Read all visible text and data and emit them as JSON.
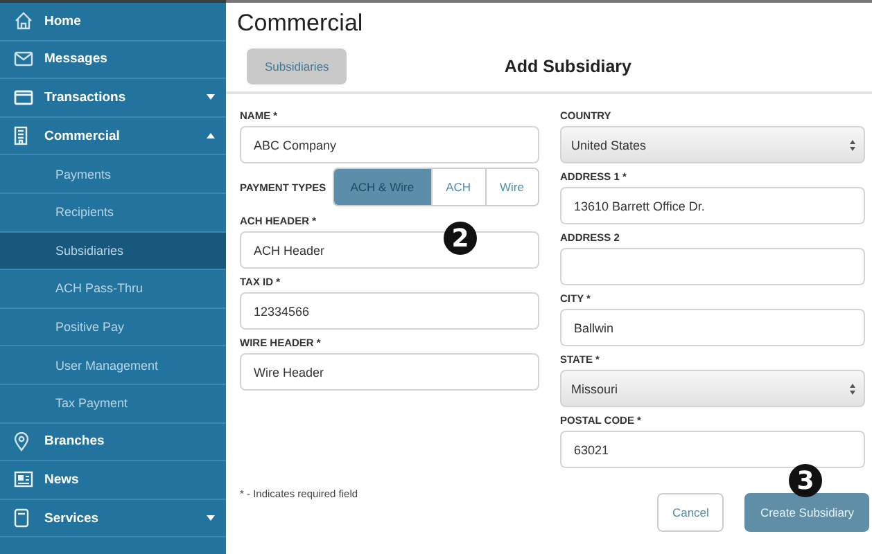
{
  "nav": {
    "items": [
      {
        "label": "Home",
        "selected": false
      },
      {
        "label": "Messages",
        "selected": false
      },
      {
        "label": "Transactions",
        "selected": false,
        "expanded": false
      },
      {
        "label": "Commercial",
        "selected": false,
        "expanded": true,
        "children": [
          {
            "label": "Payments",
            "selected": false
          },
          {
            "label": "Recipients",
            "selected": false
          },
          {
            "label": "Subsidiaries",
            "selected": true
          },
          {
            "label": "ACH Pass-Thru",
            "selected": false
          },
          {
            "label": "Positive Pay",
            "selected": false
          },
          {
            "label": "User Management",
            "selected": false
          },
          {
            "label": "Tax Payment",
            "selected": false
          }
        ]
      },
      {
        "label": "Branches",
        "selected": false
      },
      {
        "label": "News",
        "selected": false
      },
      {
        "label": "Services",
        "selected": false,
        "expanded": false
      }
    ]
  },
  "page": {
    "title": "Commercial",
    "back_button": "Subsidiaries",
    "heading": "Add Subsidiary"
  },
  "form": {
    "left_fields": [
      {
        "kind": "text",
        "label": "NAME *",
        "value": "ABC Company"
      },
      {
        "kind": "segmented",
        "label": "PAYMENT TYPES",
        "options": [
          {
            "label": "ACH & Wire",
            "selected": true
          },
          {
            "label": "ACH",
            "selected": false
          },
          {
            "label": "Wire",
            "selected": false
          }
        ]
      },
      {
        "kind": "text",
        "label": "ACH HEADER *",
        "value": "ACH Header"
      },
      {
        "kind": "text",
        "label": "TAX ID *",
        "value": "12334566"
      },
      {
        "kind": "text",
        "label": "WIRE HEADER *",
        "value": "Wire Header"
      }
    ],
    "right_fields": [
      {
        "kind": "select",
        "label": "COUNTRY",
        "value": "United States"
      },
      {
        "kind": "text",
        "label": "ADDRESS 1 *",
        "value": "13610 Barrett Office Dr."
      },
      {
        "kind": "text",
        "label": "ADDRESS 2"
      },
      {
        "kind": "text",
        "label": "CITY *",
        "value": "Ballwin"
      },
      {
        "kind": "select",
        "label": "STATE *",
        "value": "Missouri"
      },
      {
        "kind": "text",
        "label": "POSTAL CODE *",
        "value": "63021"
      }
    ],
    "note": "* - Indicates required field",
    "cancel_button": "Cancel",
    "submit_button": "Create Subsidiary"
  },
  "callouts": [
    {
      "text": "2"
    },
    {
      "text": "3"
    }
  ]
}
